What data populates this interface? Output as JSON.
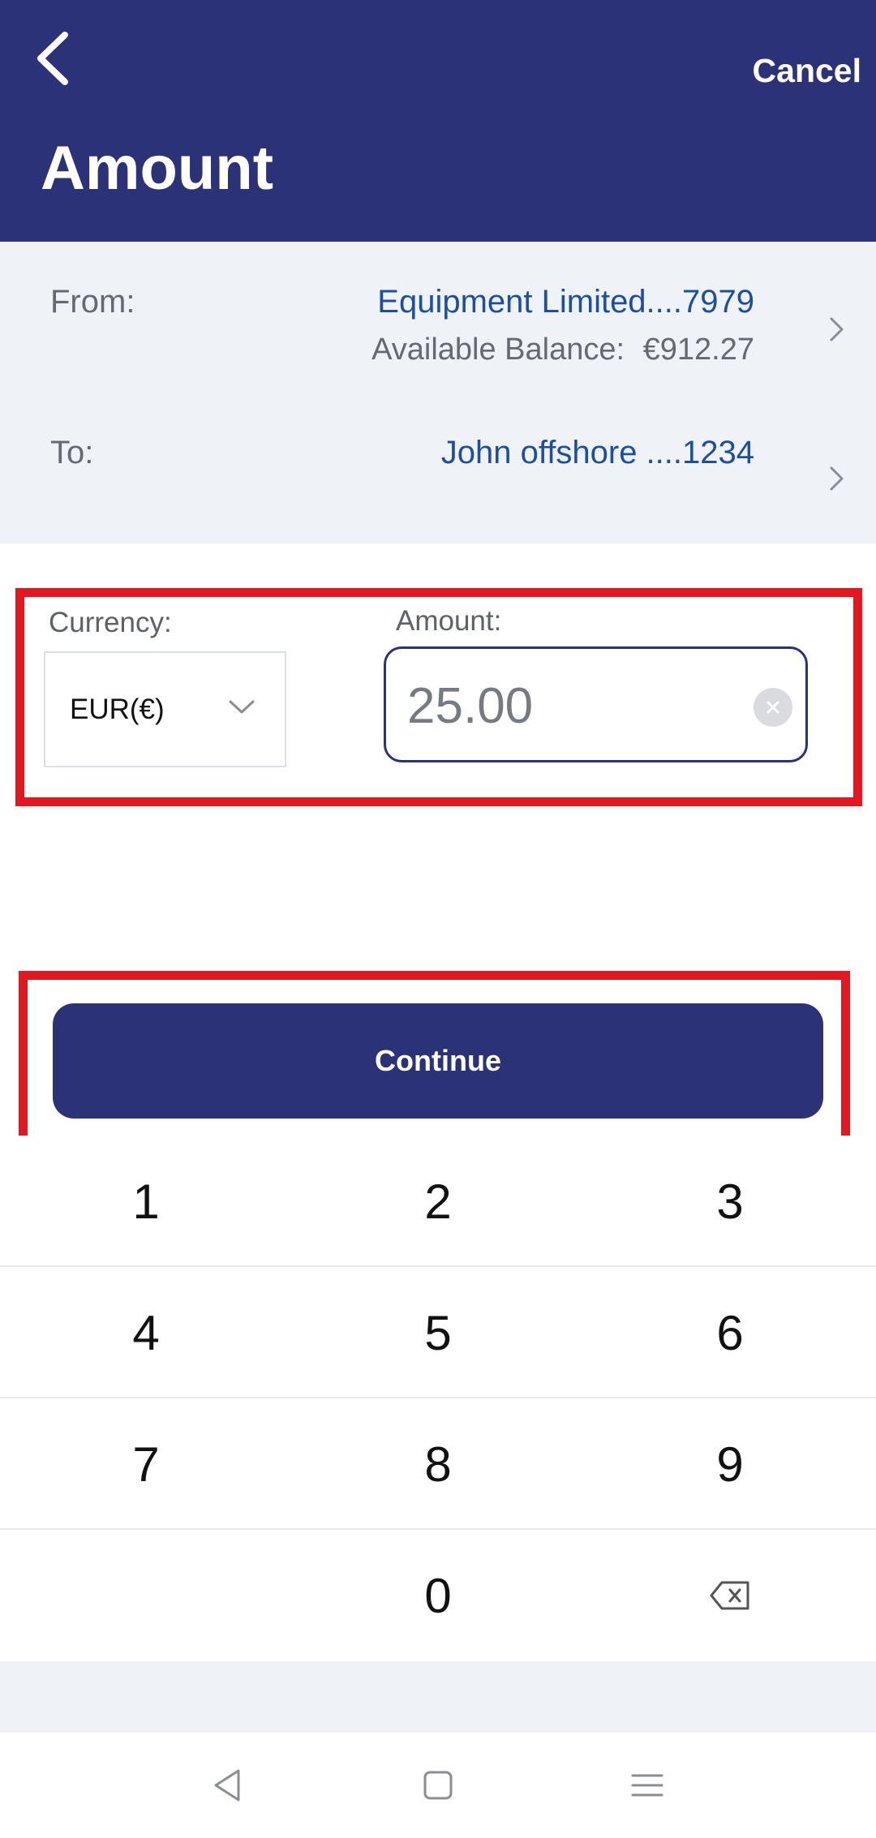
{
  "header": {
    "title": "Amount",
    "cancel_label": "Cancel",
    "back_icon": "chevron-left-icon"
  },
  "accounts": {
    "from_label": "From:",
    "from_name": "Equipment Limited....7979",
    "balance_label": "Available Balance:",
    "balance_value": "€912.27",
    "to_label": "To:",
    "to_name": "John offshore ....1234"
  },
  "form": {
    "currency_label": "Currency:",
    "currency_value": "EUR(€)",
    "amount_label": "Amount:",
    "amount_value": "25.00"
  },
  "continue_label": "Continue",
  "keypad": {
    "rows": [
      [
        "1",
        "2",
        "3"
      ],
      [
        "4",
        "5",
        "6"
      ],
      [
        "7",
        "8",
        "9"
      ],
      [
        "",
        "0",
        "backspace"
      ]
    ]
  },
  "colors": {
    "brand": "#2b3277",
    "link": "#1d4f9e",
    "highlight": "#e3171f",
    "panel": "#eff2f6"
  }
}
